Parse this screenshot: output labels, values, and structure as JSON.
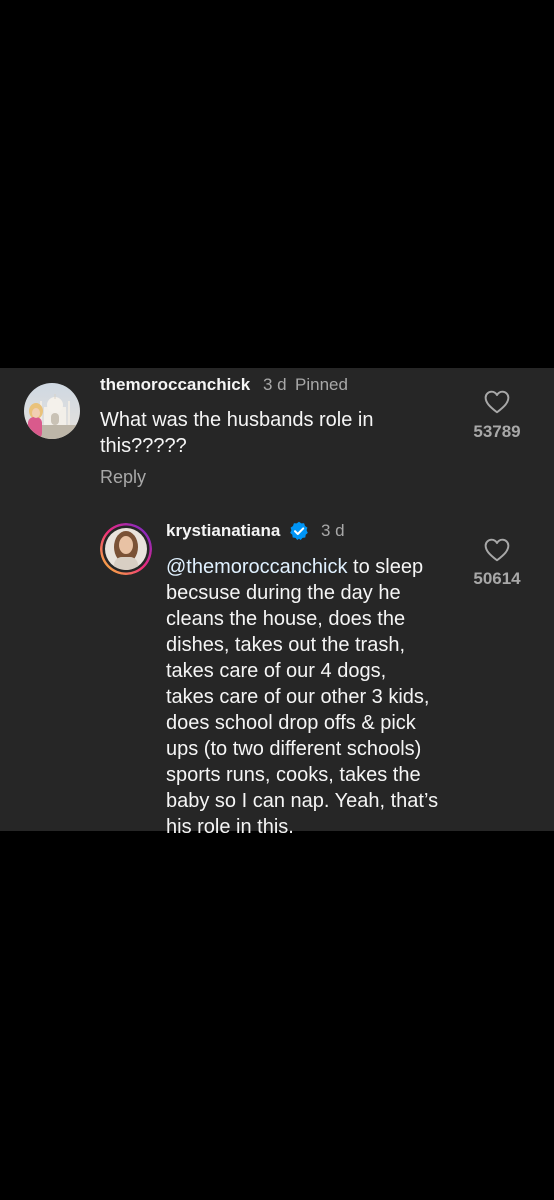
{
  "comment": {
    "username": "themoroccanchick",
    "time": "3 d",
    "pinned": "Pinned",
    "text_line1": "What was the husbands role in",
    "text_line2": "this?????",
    "reply_label": "Reply",
    "likes": "53789"
  },
  "reply": {
    "username": "krystianatiana",
    "time": "3 d",
    "mention": "@themoroccanchick",
    "lines": [
      " to sleep",
      "becsuse during the day he",
      "cleans the house, does the",
      "dishes, takes out the trash,",
      "takes care of our 4 dogs,",
      "takes care of our other 3 kids,",
      "does school drop offs & pick",
      "ups (to two different schools)",
      "sports runs, cooks, takes the",
      "baby so I can nap. Yeah, that’s",
      "his role in this."
    ],
    "likes": "50614"
  },
  "icons": {
    "heart": "heart-outline-icon",
    "verified": "verified-badge-icon"
  },
  "colors": {
    "panel_bg": "#262626",
    "verified_blue": "#0095f6",
    "story_ring_start": "#f9ce34",
    "story_ring_mid": "#ee2a7b",
    "story_ring_end": "#6228d7"
  }
}
